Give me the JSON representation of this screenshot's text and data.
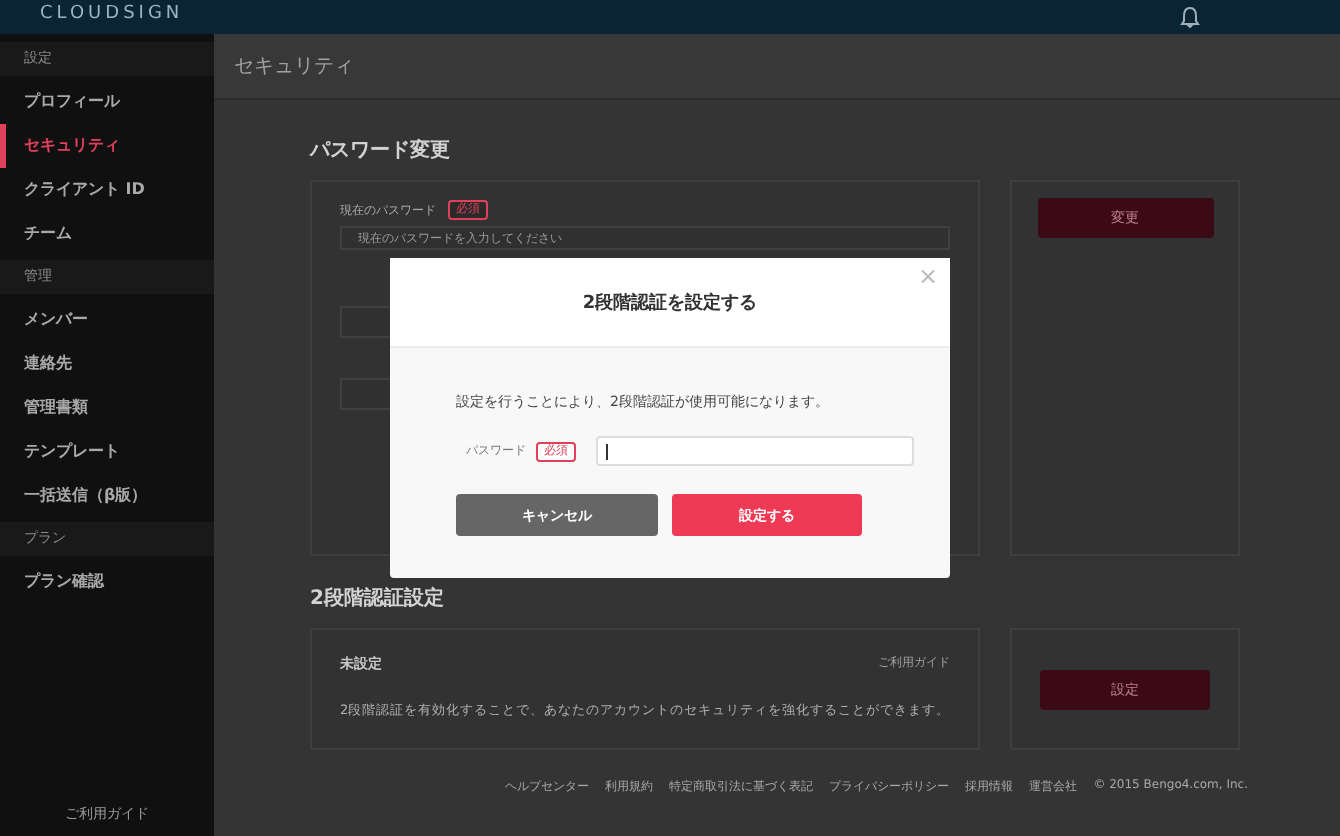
{
  "header": {
    "logo": "CLOUDSIGN"
  },
  "sidebar": {
    "sections": [
      {
        "heading": "設定",
        "items": [
          {
            "label": "プロフィール",
            "selected": false
          },
          {
            "label": "セキュリティ",
            "selected": true
          },
          {
            "label": "クライアント ID",
            "selected": false
          },
          {
            "label": "チーム",
            "selected": false
          }
        ]
      },
      {
        "heading": "管理",
        "items": [
          {
            "label": "メンバー",
            "selected": false
          },
          {
            "label": "連絡先",
            "selected": false
          },
          {
            "label": "管理書類",
            "selected": false
          },
          {
            "label": "テンプレート",
            "selected": false
          },
          {
            "label": "一括送信（β版）",
            "selected": false
          }
        ]
      },
      {
        "heading": "プラン",
        "items": [
          {
            "label": "プラン確認",
            "selected": false
          }
        ]
      }
    ],
    "guide": "ご利用ガイド"
  },
  "page_title": "セキュリティ",
  "password_section": {
    "title": "パスワード変更",
    "current_label": "現在のパスワード",
    "required": "必須",
    "current_placeholder": "現在のパスワードを入力してください",
    "button": "変更"
  },
  "two_factor_section": {
    "title": "2段階認証設定",
    "status": "未設定",
    "description": "2段階認証を有効化することで、あなたのアカウントのセキュリティを強化することができます。",
    "guide_link": "ご利用ガイド",
    "button": "設定"
  },
  "footer": [
    "ヘルプセンター",
    "利用規約",
    "特定商取引法に基づく表記",
    "プライバシーポリシー",
    "採用情報",
    "運営会社",
    "© 2015 Bengo4.com, Inc."
  ],
  "modal": {
    "title": "2段階認証を設定する",
    "close": "×",
    "message": "設定を行うことにより、2段階認証が使用可能になります。",
    "field_label": "パスワード",
    "required": "必須",
    "cancel": "キャンセル",
    "submit": "設定する"
  }
}
